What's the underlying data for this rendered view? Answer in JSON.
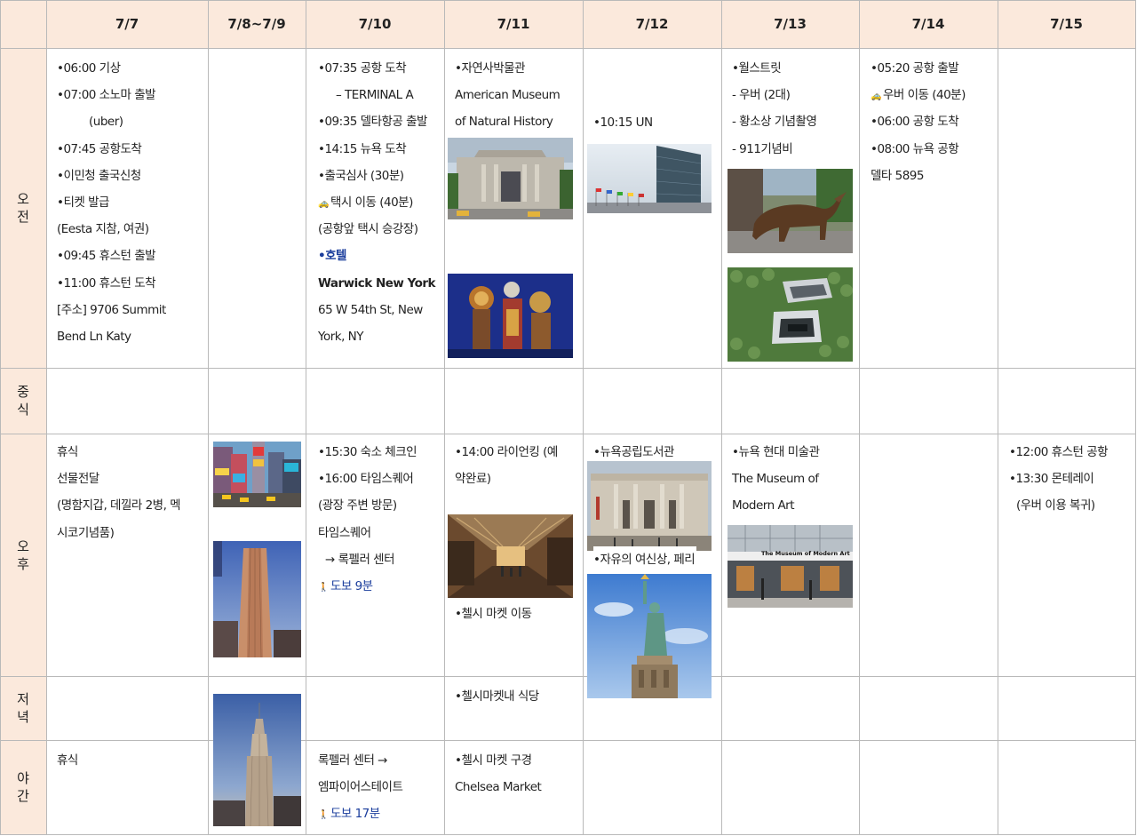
{
  "header": {
    "corner": "",
    "dates": [
      "7/7",
      "7/8~7/9",
      "7/10",
      "7/11",
      "7/12",
      "7/13",
      "7/14",
      "7/15"
    ]
  },
  "rows": {
    "morning": [
      "오",
      "전"
    ],
    "lunch": [
      "중",
      "식"
    ],
    "afternoon": [
      "오",
      "후"
    ],
    "dinner": [
      "저",
      "녁"
    ],
    "night": [
      "야",
      "간"
    ]
  },
  "d77": {
    "morning": [
      "•06:00 기상",
      "•07:00 소노마 출발",
      "(uber)",
      "•07:45 공항도착",
      "•이민청 출국신청",
      "•티켓 발급",
      "(Eesta 지참, 여권)",
      "•09:45 휴스턴 출발",
      "•11:00 휴스턴 도착",
      "[주소] 9706 Summit",
      "Bend Ln Katy"
    ],
    "afternoon": [
      "휴식",
      "선물전달",
      "(명함지갑, 데낄라 2병, 멕",
      "시코기념품)"
    ],
    "night": [
      "휴식"
    ]
  },
  "d710": {
    "morning": [
      "•07:35 공항 도착",
      "– TERMINAL  A",
      "•09:35 델타항공 출발",
      "•14:15 뉴욕 도착",
      "•출국심사 (30분)",
      "택시 이동 (40분)",
      "(공항앞 택시 승강장)",
      "•호텔",
      "Warwick New York",
      "65 W 54th St, New",
      "York, NY"
    ],
    "afternoon": [
      "•15:30 숙소 체크인",
      "•16:00 타임스퀘어",
      "(광장 주변 방문)",
      "타임스퀘어",
      "→ 록펠러 센터",
      "도보 9분"
    ],
    "night": [
      "록펠러 센터 →",
      "엠파이어스테이트",
      "도보 17분"
    ]
  },
  "d711": {
    "morning": [
      "•자연사박물관",
      "American Museum",
      "of Natural History"
    ],
    "afternoon_a": [
      "•14:00 라이언킹 (예",
      "약완료)"
    ],
    "afternoon_b": [
      "•첼시 마켓 이동"
    ],
    "dinner": [
      "•첼시마켓내 식당"
    ],
    "night": [
      "•첼시 마켓 구경",
      "Chelsea Market"
    ]
  },
  "d712": {
    "morning": [
      "•10:15 UN"
    ],
    "afternoon_a": [
      "•뉴욕공립도서관"
    ],
    "afternoon_b": [
      "•자유의 여신상, 페리"
    ]
  },
  "d713": {
    "morning": [
      "•월스트릿",
      "- 우버 (2대)",
      "- 황소상 기념촬영",
      "- 911기념비"
    ],
    "afternoon": [
      "•뉴욕 현대 미술관",
      "The Museum of",
      "Modern Art"
    ]
  },
  "d714": {
    "morning": [
      "•05:20 공항 출발",
      "우버 이동 (40분)",
      "•06:00 공항 도착",
      "•08:00 뉴욕 공항",
      "델타 5895"
    ]
  },
  "d715": {
    "afternoon": [
      "•12:00 휴스턴 공항",
      "•13:30 몬테레이",
      "(우버 이용 복귀)"
    ]
  },
  "photo_text": {
    "moma_sign": "The Museum of Modern Art"
  },
  "colors": {
    "header_bg": "#fbe9dc",
    "grid": "#b9b9b9",
    "link_blue": "#1a3d9c"
  }
}
